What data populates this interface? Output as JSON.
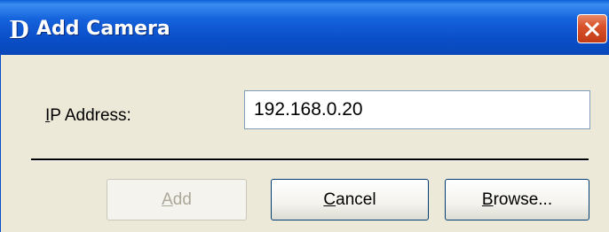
{
  "window": {
    "title": "Add Camera",
    "icon_letter": "D",
    "colors": {
      "titlebar": "#0a4fc8",
      "close_button": "#d9532c",
      "body": "#ece9d8"
    }
  },
  "form": {
    "ip_label_mnemonic": "I",
    "ip_label_rest": "P Address:",
    "ip_value": "192.168.0.20"
  },
  "buttons": {
    "add": {
      "mnemonic": "A",
      "rest": "dd",
      "disabled": true
    },
    "cancel": {
      "mnemonic": "C",
      "rest": "ancel"
    },
    "browse": {
      "mnemonic": "B",
      "rest": "rowse..."
    }
  },
  "icons": {
    "close": "close-icon",
    "app": "dlink-logo-icon"
  }
}
